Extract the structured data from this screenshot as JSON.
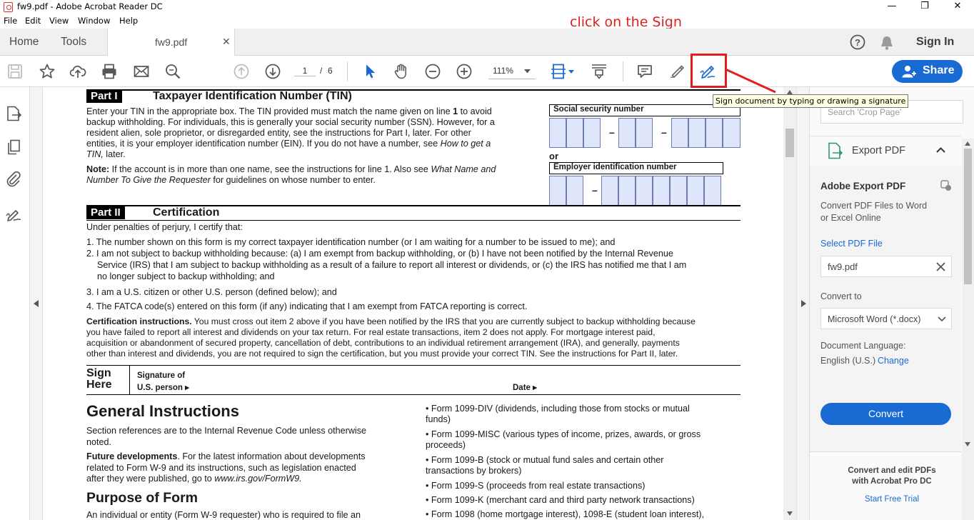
{
  "window": {
    "title": "fw9.pdf - Adobe Acrobat Reader DC",
    "minimize": "—",
    "maximize": "❐",
    "close": "✕"
  },
  "menu": [
    "File",
    "Edit",
    "View",
    "Window",
    "Help"
  ],
  "tabs": {
    "home": "Home",
    "tools": "Tools",
    "file": "fw9.pdf",
    "close": "✕",
    "sign_in": "Sign In"
  },
  "toolbar": {
    "page_current": "1",
    "page_sep": "/",
    "page_total": "6",
    "zoom": "111%",
    "share": "Share"
  },
  "annotation": {
    "label": "click on the Sign",
    "tooltip": "Sign document by typing or drawing a signature",
    "color": "#e0201e"
  },
  "right_panel": {
    "search_placeholder": "Search 'Crop Page'",
    "export_title": "Export PDF",
    "adobe_export": "Adobe Export PDF",
    "desc_line1": "Convert PDF Files to Word",
    "desc_line2": "or Excel Online",
    "select_file": "Select PDF File",
    "file_name": "fw9.pdf",
    "convert_to": "Convert to",
    "format": "Microsoft Word (*.docx)",
    "doc_language": "Document Language:",
    "language": "English (U.S.)",
    "change": "Change",
    "convert_button": "Convert",
    "promo_line1": "Convert and edit PDFs",
    "promo_line2": "with Acrobat Pro DC",
    "trial": "Start Free Trial"
  },
  "form": {
    "part1_tag": "Part I",
    "part1_title": "Taxpayer Identification Number (TIN)",
    "p1_l1a": "Enter your TIN in the appropriate box. The TIN provided must match the name given on line ",
    "p1_l1b": "1",
    "p1_l1c": " to avoid",
    "p1_l2": "backup withholding. For individuals, this is generally your social security number (SSN). However, for a",
    "p1_l3": "resident alien, sole proprietor, or disregarded entity, see the instructions for Part I, later. For other",
    "p1_l4a": "entities, it is your employer identification number (EIN). If you do not have a number, see ",
    "p1_l4b": "How to get a",
    "p1_l5a": "TIN,",
    "p1_l5b": " later.",
    "note_a": "Note:",
    "note_b": " If the account is in more than one name, see the instructions for line 1. Also see ",
    "note_c": "What Name and",
    "note_d": "Number To Give the Requester",
    "note_e": " for guidelines on whose number to enter.",
    "ssn_label": "Social security number",
    "or": "or",
    "ein_label": "Employer identification number",
    "dash": "–",
    "part2_tag": "Part II",
    "part2_title": "Certification",
    "perjury": "Under penalties of perjury, I certify that:",
    "item1": "1. The number shown on this form is my correct taxpayer identification number (or I am waiting for a number to be issued to me); and",
    "item2a": "2. I am not subject to backup withholding because: (a) I am exempt from backup withholding, or (b) I have not been notified by the Internal Revenue",
    "item2b": "Service (IRS) that I am subject to backup withholding as a result of a failure to report all interest or dividends, or (c) the IRS has notified me that I am",
    "item2c": "no longer subject to backup withholding; and",
    "item3": "3. I am a U.S. citizen or other U.S. person (defined below); and",
    "item4": "4. The FATCA code(s) entered on this form (if any) indicating that I am exempt from FATCA reporting is correct.",
    "cert_a": "Certification instructions.",
    "cert_b": " You must cross out item 2 above if you have been notified by the IRS that you are currently subject to backup withholding because",
    "cert_l2": "you have failed to report all interest and dividends on your tax return. For real estate transactions, item 2 does not apply. For mortgage interest paid,",
    "cert_l3": "acquisition or abandonment of secured property, cancellation of debt, contributions to an individual retirement arrangement (IRA), and generally, payments",
    "cert_l4": "other than interest and dividends, you are not required to sign the certification, but you must provide your correct TIN. See the instructions for Part II, later.",
    "sign": "Sign",
    "here": "Here",
    "sig_of": "Signature of",
    "us_person": "U.S. person ▸",
    "date": "Date ▸",
    "gen_title": "General Instructions",
    "sec_ref1": "Section references are to the Internal Revenue Code unless otherwise",
    "sec_ref2": "noted.",
    "future_a": "Future developments",
    "future_b": ". For the latest information about developments",
    "future_l2": "related to Form W-9 and its instructions, such as legislation enacted",
    "future_l3a": "after they were published, go to ",
    "future_l3b": "www.irs.gov/FormW9.",
    "purpose_title": "Purpose of Form",
    "purpose_l1": "An individual or entity (Form W-9 requester) who is required to file an",
    "b1a": "• Form 1099-DIV (dividends, including those from stocks or mutual",
    "b1b": "funds)",
    "b2a": "• Form 1099-MISC (various types of income, prizes, awards, or gross",
    "b2b": "proceeds)",
    "b3a": "• Form 1099-B (stock or mutual fund sales and certain other",
    "b3b": "transactions by brokers)",
    "b4": "• Form 1099-S (proceeds from real estate transactions)",
    "b5": "• Form 1099-K (merchant card and third party network transactions)",
    "b6": "• Form 1098 (home mortgage interest), 1098-E (student loan interest),"
  }
}
